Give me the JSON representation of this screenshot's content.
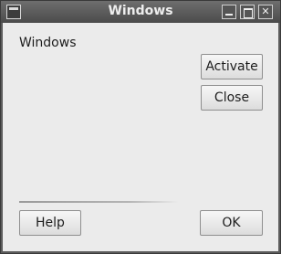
{
  "window": {
    "title": "Windows"
  },
  "content": {
    "label": "Windows"
  },
  "buttons": {
    "activate": "Activate",
    "close": "Close",
    "help": "Help",
    "ok": "OK"
  }
}
